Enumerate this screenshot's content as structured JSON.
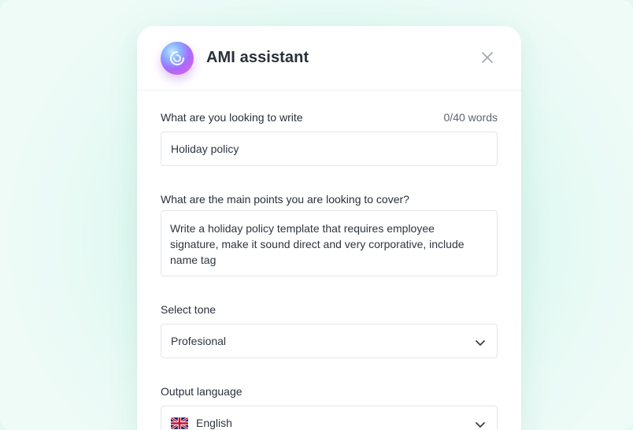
{
  "assistant": {
    "title": "AMI assistant"
  },
  "form": {
    "write": {
      "label": "What are you looking to write",
      "counter": "0/40 words",
      "value": "Holiday policy"
    },
    "points": {
      "label": "What are the main points you are looking to cover?",
      "value": "Write a holiday policy template that requires employee\nsignature, make it sound direct and very corporative, include\nname tag"
    },
    "tone": {
      "label": "Select tone",
      "selected": "Profesional"
    },
    "language": {
      "label": "Output language",
      "selected": "English",
      "flag_icon": "uk-flag-icon"
    }
  },
  "icons": {
    "logo": "swirl-logo-icon",
    "close": "close-icon",
    "chevron": "chevron-down-icon"
  },
  "colors": {
    "background": "#d8f7ee",
    "panel": "#ffffff",
    "text": "#2a2f3a",
    "border": "#e2e6ea"
  }
}
